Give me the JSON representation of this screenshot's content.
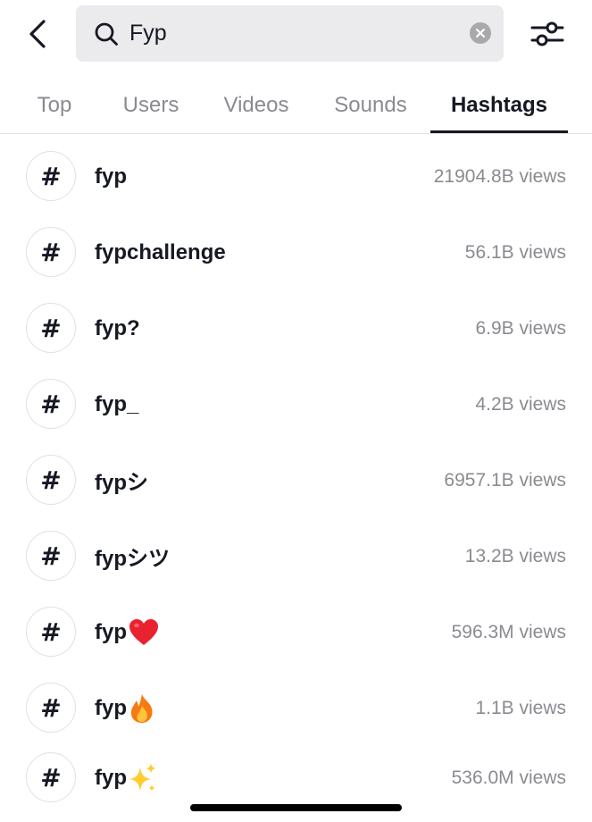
{
  "search": {
    "query": "Fyp"
  },
  "icons": {
    "back": "chevron-left-icon",
    "search": "magnifier-icon",
    "clear": "close-circle-icon",
    "filter": "sliders-icon",
    "hashtag": "#"
  },
  "tabs": [
    {
      "label": "Top",
      "active": false
    },
    {
      "label": "Users",
      "active": false
    },
    {
      "label": "Videos",
      "active": false
    },
    {
      "label": "Sounds",
      "active": false
    },
    {
      "label": "Hashtags",
      "active": true
    }
  ],
  "hashtags": [
    {
      "name": "fyp",
      "emoji": "",
      "views": "21904.8B views"
    },
    {
      "name": "fypchallenge",
      "emoji": "",
      "views": "56.1B views"
    },
    {
      "name": "fyp?",
      "emoji": "",
      "views": "6.9B views"
    },
    {
      "name": "fyp_",
      "emoji": "",
      "views": "4.2B views"
    },
    {
      "name": "fypシ",
      "emoji": "",
      "views": "6957.1B views"
    },
    {
      "name": "fypシツ",
      "emoji": "",
      "views": "13.2B views"
    },
    {
      "name": "fyp",
      "emoji": "heart",
      "views": "596.3M views"
    },
    {
      "name": "fyp",
      "emoji": "fire",
      "views": "1.1B views"
    },
    {
      "name": "fyp",
      "emoji": "sparkles",
      "views": "536.0M views"
    }
  ],
  "colors": {
    "text_primary": "#161823",
    "text_secondary": "#8a8b91",
    "search_bg": "#ebebed",
    "divider": "#e3e3e4"
  }
}
